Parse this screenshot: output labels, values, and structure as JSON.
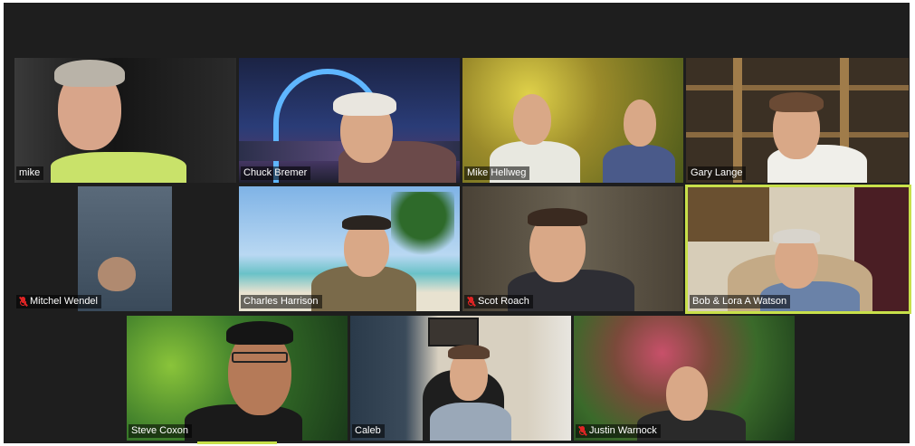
{
  "meeting": {
    "accent_color": "#c8e04a",
    "muted_icon_color": "#e02424",
    "participants": [
      {
        "name": "mike",
        "muted": false
      },
      {
        "name": "Chuck Bremer",
        "muted": false
      },
      {
        "name": "Mike Hellweg",
        "muted": false
      },
      {
        "name": "Gary Lange",
        "muted": false
      },
      {
        "name": "Mitchel Wendel",
        "muted": true
      },
      {
        "name": "Charles Harrison",
        "muted": false
      },
      {
        "name": "Scot Roach",
        "muted": true
      },
      {
        "name": "Bob & Lora A Watson",
        "muted": false,
        "active_speaker": true
      },
      {
        "name": "Steve Coxon",
        "muted": false
      },
      {
        "name": "Caleb",
        "muted": false
      },
      {
        "name": "Justin Warnock",
        "muted": true
      }
    ]
  }
}
